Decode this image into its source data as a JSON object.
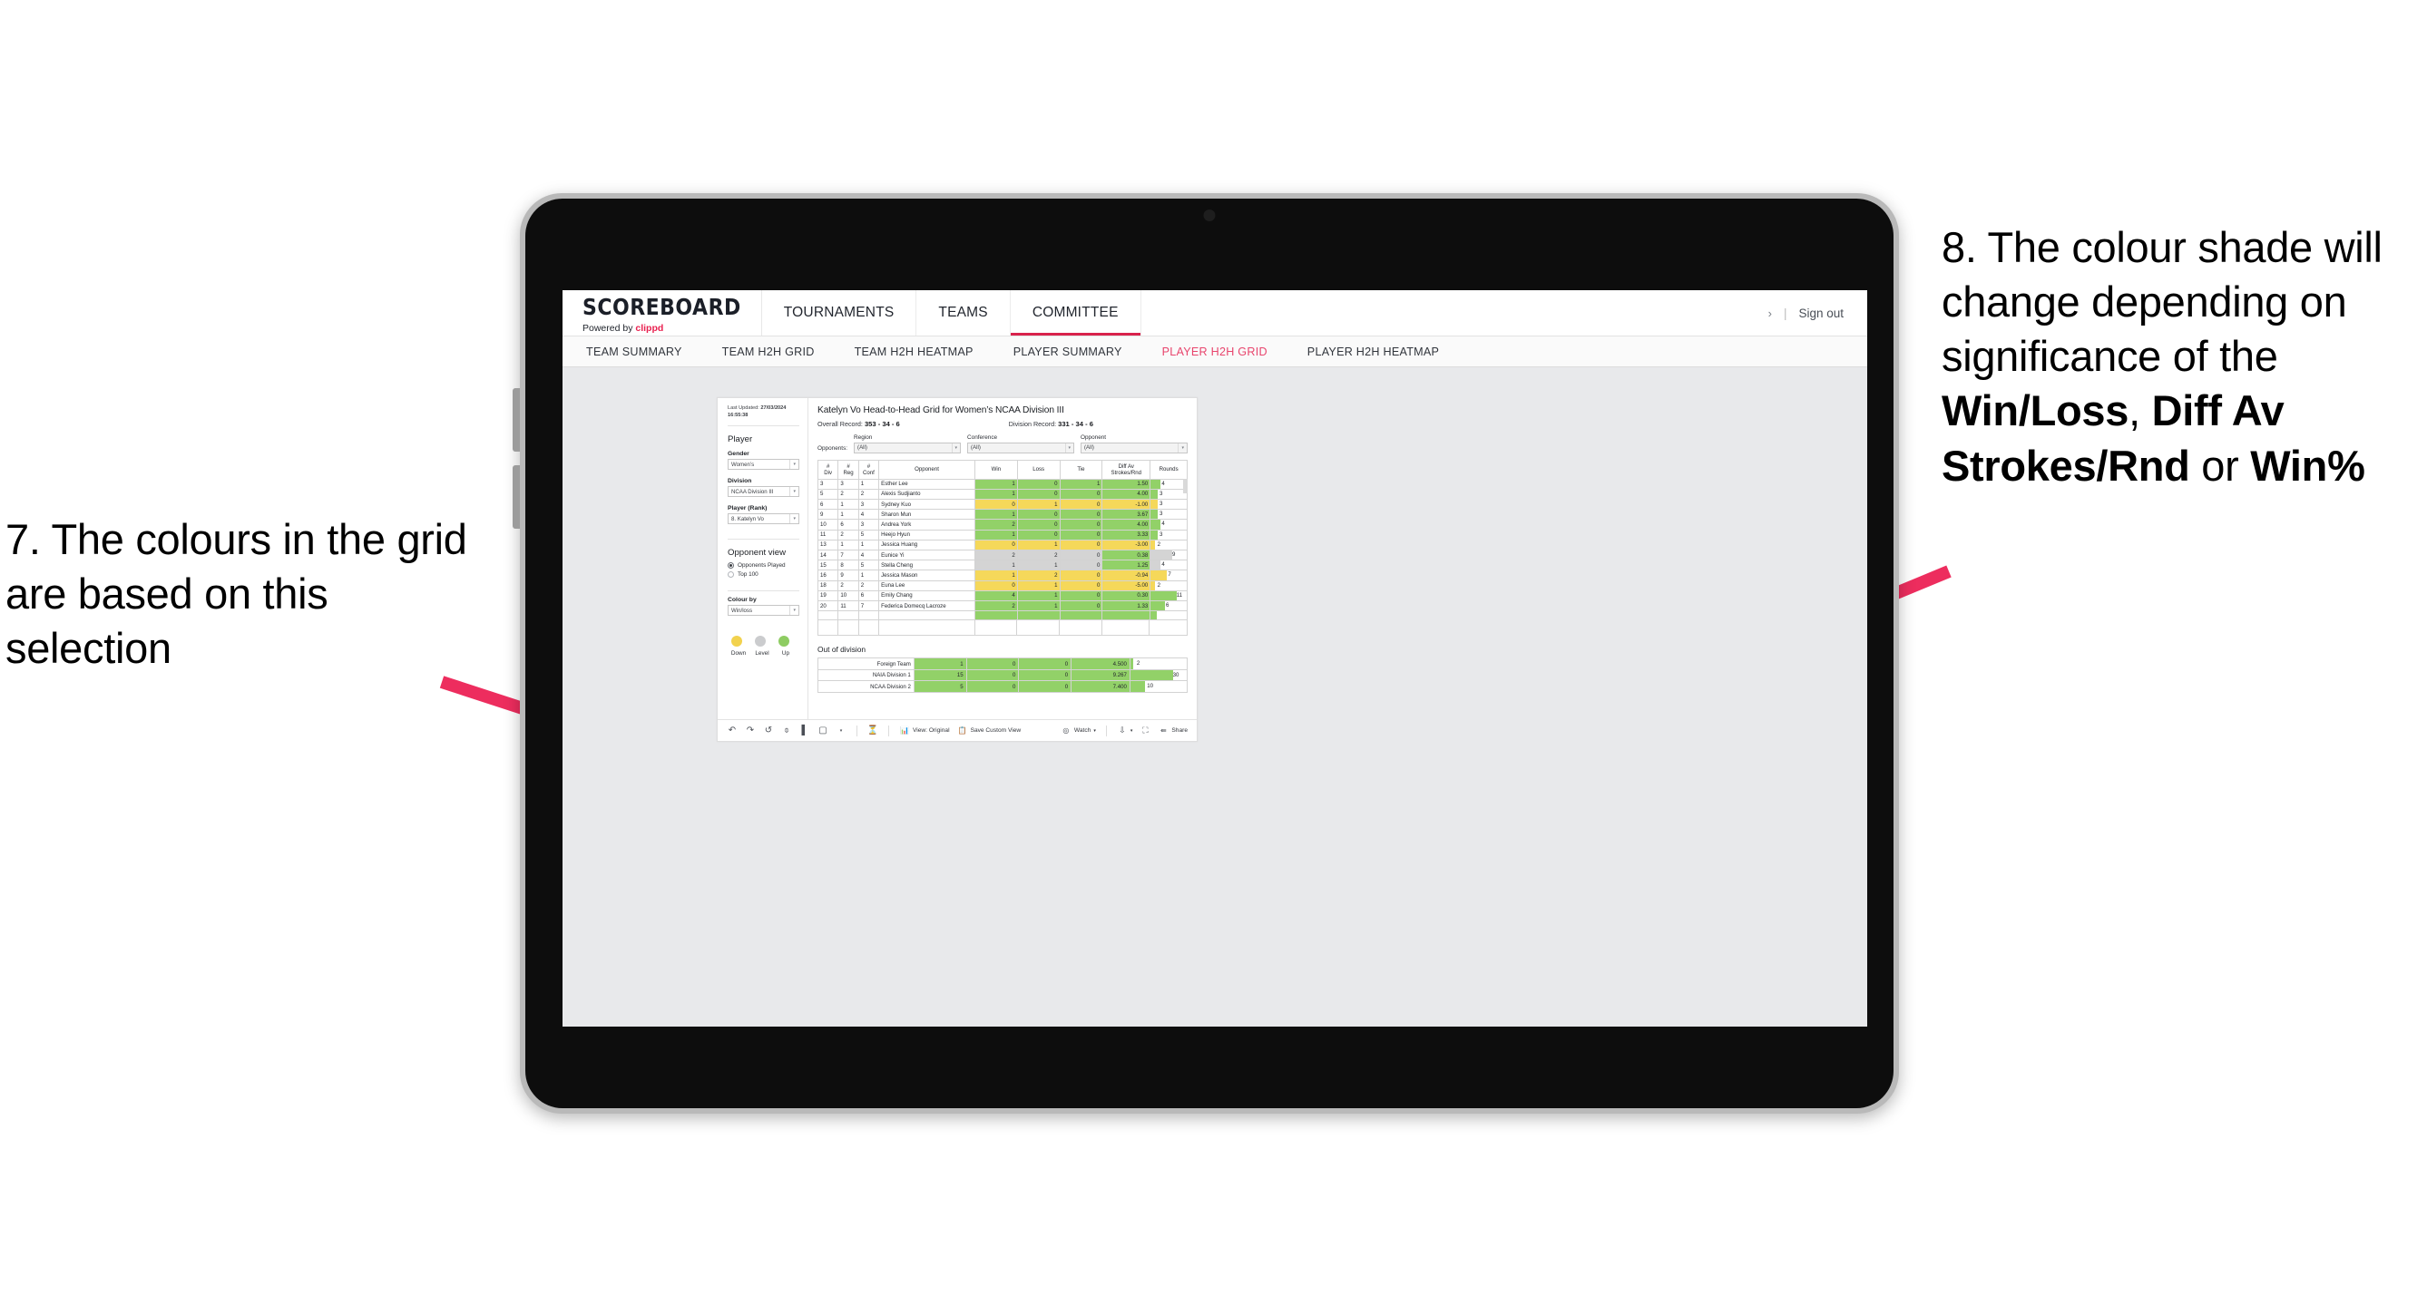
{
  "annotations": {
    "left": "7. The colours in the grid are based on this selection",
    "right_parts": [
      {
        "text": "8. The colour shade will change depending on significance of the ",
        "bold": false
      },
      {
        "text": "Win/Loss",
        "bold": true
      },
      {
        "text": ", ",
        "bold": false
      },
      {
        "text": "Diff Av Strokes/Rnd",
        "bold": true
      },
      {
        "text": " or ",
        "bold": false
      },
      {
        "text": "Win%",
        "bold": true
      }
    ],
    "arrow_color": "#ED2D5E"
  },
  "app": {
    "logo": {
      "main": "SCOREBOARD",
      "powered": "Powered by ",
      "brand": "clippd"
    },
    "topnav": [
      {
        "label": "TOURNAMENTS",
        "active": false
      },
      {
        "label": "TEAMS",
        "active": false
      },
      {
        "label": "COMMITTEE",
        "active": true
      }
    ],
    "topright": {
      "chevron": "›",
      "sep": "|",
      "signout": "Sign out"
    },
    "subnav": [
      {
        "label": "TEAM SUMMARY",
        "active": false
      },
      {
        "label": "TEAM H2H GRID",
        "active": false
      },
      {
        "label": "TEAM H2H HEATMAP",
        "active": false
      },
      {
        "label": "PLAYER SUMMARY",
        "active": false
      },
      {
        "label": "PLAYER H2H GRID",
        "active": true
      },
      {
        "label": "PLAYER H2H HEATMAP",
        "active": false
      }
    ],
    "accent": "#E8456D"
  },
  "pane": {
    "updated_label": "Last Updated: ",
    "updated_date": "27/03/2024",
    "updated_time": "16:55:38",
    "player_heading": "Player",
    "fields": [
      {
        "label": "Gender",
        "value": "Women’s"
      },
      {
        "label": "Division",
        "value": "NCAA Division III"
      },
      {
        "label": "Player (Rank)",
        "value": "8. Katelyn Vo"
      }
    ],
    "opponent_view_heading": "Opponent view",
    "opponent_view_options": [
      {
        "label": "Opponents Played",
        "selected": true
      },
      {
        "label": "Top 100",
        "selected": false
      }
    ],
    "colour_by_label": "Colour by",
    "colour_by_value": "Win/loss",
    "legend": [
      {
        "label": "Down",
        "color": "#F2D24E"
      },
      {
        "label": "Level",
        "color": "#CBCCCE"
      },
      {
        "label": "Up",
        "color": "#8ECC62"
      }
    ]
  },
  "viz": {
    "title": "Katelyn Vo Head-to-Head Grid for Women’s NCAA Division III",
    "overall_record_label": "Overall Record: ",
    "overall_record": "353 -  34 - 6",
    "division_record_label": "Division Record: ",
    "division_record": "331 -  34 - 6",
    "opponents_label": "Opponents:",
    "opponent_filters": [
      {
        "label": "Region",
        "value": "(All)"
      },
      {
        "label": "Conference",
        "value": "(All)"
      },
      {
        "label": "Opponent",
        "value": "(All)"
      }
    ],
    "columns": [
      "#\nDiv",
      "#\nReg",
      "#\nConf",
      "Opponent",
      "Win",
      "Loss",
      "Tie",
      "Diff Av\nStrokes/Rnd",
      "Rounds"
    ],
    "column_labels": [
      {
        "l1": "#",
        "l2": "Div"
      },
      {
        "l1": "#",
        "l2": "Reg"
      },
      {
        "l1": "#",
        "l2": "Conf"
      },
      {
        "l1": "Opponent",
        "l2": ""
      },
      {
        "l1": "Win",
        "l2": ""
      },
      {
        "l1": "Loss",
        "l2": ""
      },
      {
        "l1": "Tie",
        "l2": ""
      },
      {
        "l1": "Diff Av",
        "l2": "Strokes/Rnd"
      },
      {
        "l1": "Rounds",
        "l2": ""
      }
    ],
    "rows": [
      {
        "div": "3",
        "reg": "3",
        "conf": "1",
        "opponent": "Esther Lee",
        "win": "1",
        "loss": "0",
        "tie": "1",
        "diff": "1.50",
        "rounds": "4",
        "color": "green"
      },
      {
        "div": "5",
        "reg": "2",
        "conf": "2",
        "opponent": "Alexis Sudjianto",
        "win": "1",
        "loss": "0",
        "tie": "0",
        "diff": "4.00",
        "rounds": "3",
        "color": "green"
      },
      {
        "div": "6",
        "reg": "1",
        "conf": "3",
        "opponent": "Sydney Kuo",
        "win": "0",
        "loss": "1",
        "tie": "0",
        "diff": "-1.00",
        "rounds": "3",
        "color": "yellow"
      },
      {
        "div": "9",
        "reg": "1",
        "conf": "4",
        "opponent": "Sharon Mun",
        "win": "1",
        "loss": "0",
        "tie": "0",
        "diff": "3.67",
        "rounds": "3",
        "color": "green"
      },
      {
        "div": "10",
        "reg": "6",
        "conf": "3",
        "opponent": "Andrea York",
        "win": "2",
        "loss": "0",
        "tie": "0",
        "diff": "4.00",
        "rounds": "4",
        "color": "green"
      },
      {
        "div": "11",
        "reg": "2",
        "conf": "5",
        "opponent": "Heejo Hyun",
        "win": "1",
        "loss": "0",
        "tie": "0",
        "diff": "3.33",
        "rounds": "3",
        "color": "green"
      },
      {
        "div": "13",
        "reg": "1",
        "conf": "1",
        "opponent": "Jessica Huang",
        "win": "0",
        "loss": "1",
        "tie": "0",
        "diff": "-3.00",
        "rounds": "2",
        "color": "yellow"
      },
      {
        "div": "14",
        "reg": "7",
        "conf": "4",
        "opponent": "Eunice Yi",
        "win": "2",
        "loss": "2",
        "tie": "0",
        "diff": "0.38",
        "rounds": "9",
        "color": "grey",
        "diff_color": "green"
      },
      {
        "div": "15",
        "reg": "8",
        "conf": "5",
        "opponent": "Stella Cheng",
        "win": "1",
        "loss": "1",
        "tie": "0",
        "diff": "1.25",
        "rounds": "4",
        "color": "grey",
        "diff_color": "green"
      },
      {
        "div": "16",
        "reg": "9",
        "conf": "1",
        "opponent": "Jessica Mason",
        "win": "1",
        "loss": "2",
        "tie": "0",
        "diff": "-0.94",
        "rounds": "7",
        "color": "yellow"
      },
      {
        "div": "18",
        "reg": "2",
        "conf": "2",
        "opponent": "Euna Lee",
        "win": "0",
        "loss": "1",
        "tie": "0",
        "diff": "-5.00",
        "rounds": "2",
        "color": "yellow"
      },
      {
        "div": "19",
        "reg": "10",
        "conf": "6",
        "opponent": "Emily Chang",
        "win": "4",
        "loss": "1",
        "tie": "0",
        "diff": "0.30",
        "rounds": "11",
        "color": "green"
      },
      {
        "div": "20",
        "reg": "11",
        "conf": "7",
        "opponent": "Federica Domecq Lacroze",
        "win": "2",
        "loss": "1",
        "tie": "0",
        "diff": "1.33",
        "rounds": "6",
        "color": "green"
      }
    ],
    "out_of_division_title": "Out of division",
    "out_of_division": [
      {
        "name": "Foreign Team",
        "win": "1",
        "loss": "0",
        "tie": "0",
        "diff": "4.500",
        "rounds": "2",
        "color": "green"
      },
      {
        "name": "NAIA Division 1",
        "win": "15",
        "loss": "0",
        "tie": "0",
        "diff": "9.267",
        "rounds": "30",
        "color": "green"
      },
      {
        "name": "NCAA Division 2",
        "win": "5",
        "loss": "0",
        "tie": "0",
        "diff": "7.400",
        "rounds": "10",
        "color": "green"
      }
    ],
    "colors": {
      "green": "#92D168",
      "yellow": "#F5D85A",
      "grey": "#D4D4D4"
    }
  },
  "toolbar": {
    "icons": [
      "undo-icon",
      "redo-icon",
      "revert-icon",
      "refresh-icon",
      "pause-icon",
      "alerts-icon"
    ],
    "view_label": "View: Original",
    "save_label": "Save Custom View",
    "watch_label": "Watch",
    "share_label": "Share"
  }
}
